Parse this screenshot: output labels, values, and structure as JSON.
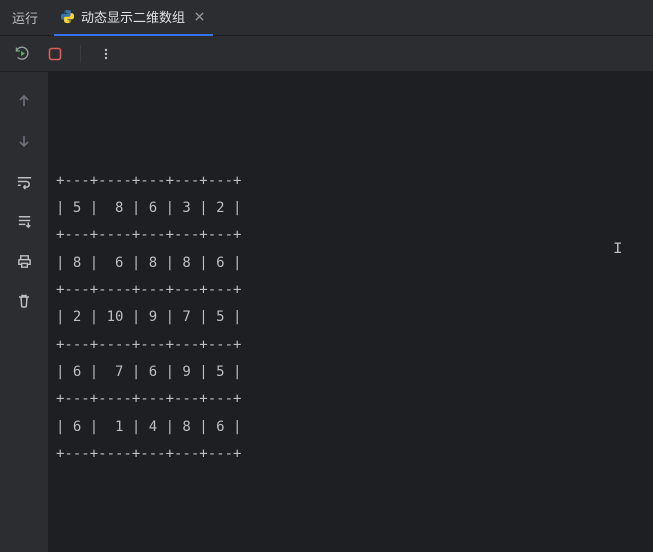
{
  "tabbar": {
    "run_label": "运行",
    "tab_title": "动态显示二维数组"
  },
  "icons": {
    "python": "python-icon",
    "close": "close-icon",
    "rerun": "rerun-icon",
    "stop": "stop-icon",
    "more": "more-icon",
    "step_over": "arrow-up-icon",
    "step_into": "arrow-down-icon",
    "wrap": "wrap-icon",
    "scroll_end": "scroll-end-icon",
    "print": "print-icon",
    "trash": "trash-icon"
  },
  "console": {
    "lines": [
      "",
      "",
      "",
      "+---+----+---+---+---+",
      "| 5 |  8 | 6 | 3 | 2 |",
      "+---+----+---+---+---+",
      "| 8 |  6 | 8 | 8 | 6 |",
      "+---+----+---+---+---+",
      "| 2 | 10 | 9 | 7 | 5 |",
      "+---+----+---+---+---+",
      "| 6 |  7 | 6 | 9 | 5 |",
      "+---+----+---+---+---+",
      "| 6 |  1 | 4 | 8 | 6 |",
      "+---+----+---+---+---+"
    ]
  },
  "chart_data": {
    "type": "table",
    "title": "动态显示二维数组",
    "rows": [
      [
        5,
        8,
        6,
        3,
        2
      ],
      [
        8,
        6,
        8,
        8,
        6
      ],
      [
        2,
        10,
        9,
        7,
        5
      ],
      [
        6,
        7,
        6,
        9,
        5
      ],
      [
        6,
        1,
        4,
        8,
        6
      ]
    ]
  }
}
